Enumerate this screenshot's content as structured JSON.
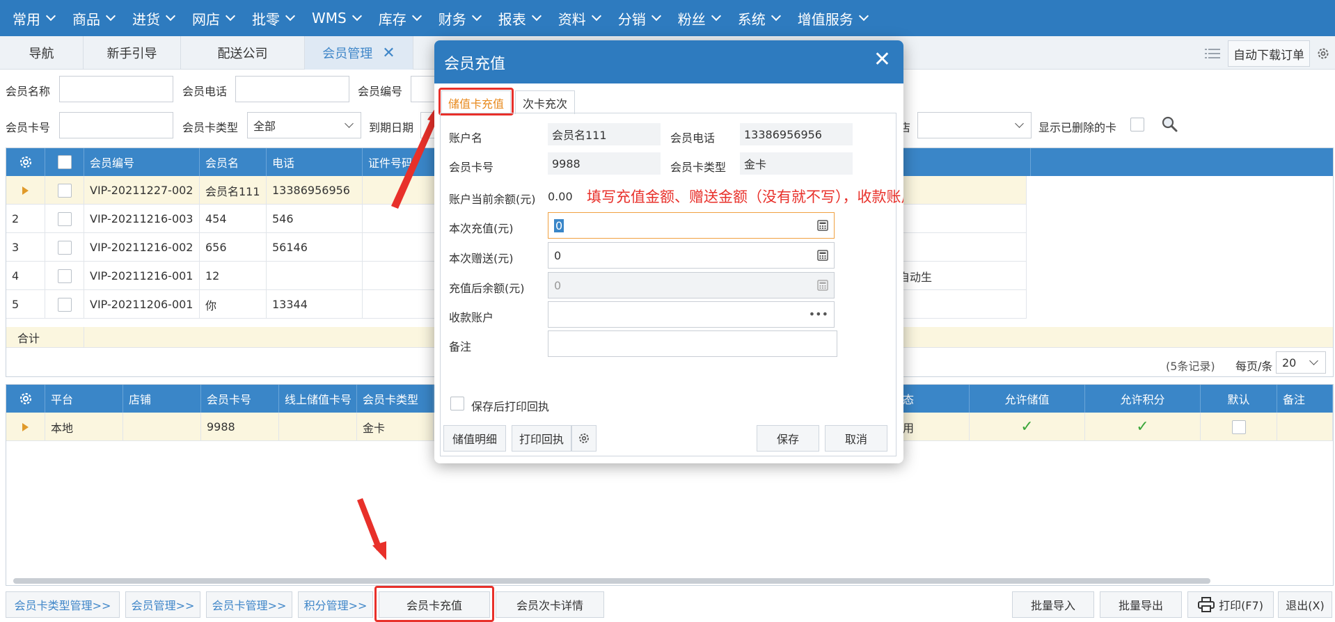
{
  "top_menu": [
    "常用",
    "商品",
    "进货",
    "网店",
    "批零",
    "WMS",
    "库存",
    "财务",
    "报表",
    "资料",
    "分销",
    "粉丝",
    "系统",
    "增值服务"
  ],
  "tabs": [
    {
      "label": "导航"
    },
    {
      "label": "新手引导"
    },
    {
      "label": "配送公司"
    },
    {
      "label": "会员管理",
      "active": true
    }
  ],
  "tab_right": {
    "auto_download": "自动下载订单"
  },
  "filters": {
    "member_name": "会员名称",
    "member_phone": "会员电话",
    "member_no": "会员编号",
    "card_no": "会员卡号",
    "card_type": "会员卡类型",
    "card_type_value": "全部",
    "expire_date": "到期日期",
    "partial_label": "店",
    "show_deleted": "显示已删除的卡"
  },
  "member_grid": {
    "headers": [
      "会员编号",
      "会员名",
      "电话",
      "证件号码"
    ],
    "rows": [
      {
        "idx": "",
        "no": "VIP-20211227-002",
        "name": "会员名111",
        "phone": "13386956956",
        "extra": ""
      },
      {
        "idx": "2",
        "no": "VIP-20211216-003",
        "name": "454",
        "phone": "546",
        "extra": ""
      },
      {
        "idx": "3",
        "no": "VIP-20211216-002",
        "name": "656",
        "phone": "56146",
        "extra": ""
      },
      {
        "idx": "4",
        "no": "VIP-20211216-001",
        "name": "12",
        "phone": "",
        "extra": "自动生"
      },
      {
        "idx": "5",
        "no": "VIP-20211206-001",
        "name": "你",
        "phone": "13344",
        "extra": ""
      }
    ],
    "total_label": "合计",
    "record_count": "(5条记录)",
    "per_page_label": "每页/条",
    "per_page_value": "20"
  },
  "card_grid": {
    "headers_left": [
      "平台",
      "店铺",
      "会员卡号",
      "线上储值卡号",
      "会员卡类型"
    ],
    "headers_right": [
      "态",
      "允许储值",
      "允许积分",
      "默认",
      "备注"
    ],
    "row": {
      "platform": "本地",
      "shop": "",
      "card_no": "9988",
      "online_card": "",
      "card_type": "金卡",
      "status": "用"
    }
  },
  "bottom_bar": {
    "left": [
      "会员卡类型管理>>",
      "会员管理>>",
      "会员卡管理>>",
      "积分管理>>"
    ],
    "recharge": "会员卡充值",
    "times_detail": "会员次卡详情",
    "batch_import": "批量导入",
    "batch_export": "批量导出",
    "print": "打印(F7)",
    "exit": "退出(X)"
  },
  "modal": {
    "title": "会员充值",
    "tab_stored": "储值卡充值",
    "tab_times": "次卡充次",
    "account_name_label": "账户名",
    "account_name": "会员名111",
    "phone_label": "会员电话",
    "phone": "13386956956",
    "card_no_label": "会员卡号",
    "card_no": "9988",
    "card_type_label": "会员卡类型",
    "card_type": "金卡",
    "balance_label": "账户当前余额(元)",
    "balance": "0.00",
    "recharge_label": "本次充值(元)",
    "recharge_value": "0",
    "gift_label": "本次赠送(元)",
    "gift_value": "0",
    "after_label": "充值后余额(元)",
    "after_value": "0",
    "account_label": "收款账户",
    "remark_label": "备注",
    "print_after_save": "保存后打印回执",
    "btn_detail": "储值明细",
    "btn_print": "打印回执",
    "btn_save": "保存",
    "btn_cancel": "取消"
  },
  "annotation": "填写充值金额、赠送金额（没有就不写），收款账户，点击“保存”",
  "colors": {
    "primary": "#2e7bbf",
    "annotation_red": "#e8302a",
    "active_tab_orange": "#e8891c"
  }
}
